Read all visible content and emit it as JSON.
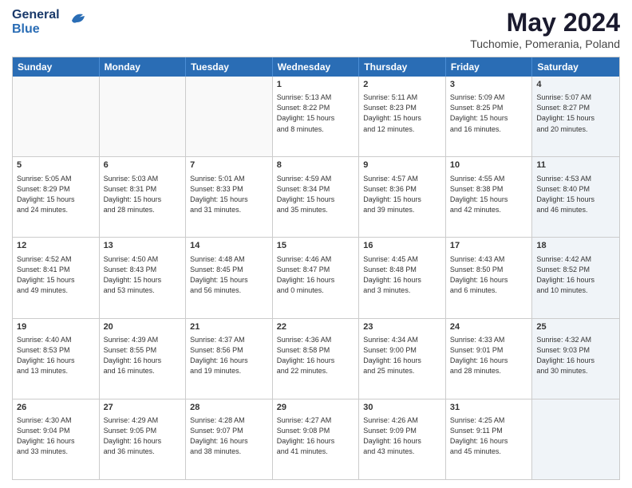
{
  "header": {
    "logo_general": "General",
    "logo_blue": "Blue",
    "title": "May 2024",
    "subtitle": "Tuchomie, Pomerania, Poland"
  },
  "weekdays": [
    "Sunday",
    "Monday",
    "Tuesday",
    "Wednesday",
    "Thursday",
    "Friday",
    "Saturday"
  ],
  "weeks": [
    [
      {
        "day": "",
        "info": "",
        "shaded": false,
        "empty": true
      },
      {
        "day": "",
        "info": "",
        "shaded": false,
        "empty": true
      },
      {
        "day": "",
        "info": "",
        "shaded": false,
        "empty": true
      },
      {
        "day": "1",
        "info": "Sunrise: 5:13 AM\nSunset: 8:22 PM\nDaylight: 15 hours\nand 8 minutes.",
        "shaded": false,
        "empty": false
      },
      {
        "day": "2",
        "info": "Sunrise: 5:11 AM\nSunset: 8:23 PM\nDaylight: 15 hours\nand 12 minutes.",
        "shaded": false,
        "empty": false
      },
      {
        "day": "3",
        "info": "Sunrise: 5:09 AM\nSunset: 8:25 PM\nDaylight: 15 hours\nand 16 minutes.",
        "shaded": false,
        "empty": false
      },
      {
        "day": "4",
        "info": "Sunrise: 5:07 AM\nSunset: 8:27 PM\nDaylight: 15 hours\nand 20 minutes.",
        "shaded": true,
        "empty": false
      }
    ],
    [
      {
        "day": "5",
        "info": "Sunrise: 5:05 AM\nSunset: 8:29 PM\nDaylight: 15 hours\nand 24 minutes.",
        "shaded": false,
        "empty": false
      },
      {
        "day": "6",
        "info": "Sunrise: 5:03 AM\nSunset: 8:31 PM\nDaylight: 15 hours\nand 28 minutes.",
        "shaded": false,
        "empty": false
      },
      {
        "day": "7",
        "info": "Sunrise: 5:01 AM\nSunset: 8:33 PM\nDaylight: 15 hours\nand 31 minutes.",
        "shaded": false,
        "empty": false
      },
      {
        "day": "8",
        "info": "Sunrise: 4:59 AM\nSunset: 8:34 PM\nDaylight: 15 hours\nand 35 minutes.",
        "shaded": false,
        "empty": false
      },
      {
        "day": "9",
        "info": "Sunrise: 4:57 AM\nSunset: 8:36 PM\nDaylight: 15 hours\nand 39 minutes.",
        "shaded": false,
        "empty": false
      },
      {
        "day": "10",
        "info": "Sunrise: 4:55 AM\nSunset: 8:38 PM\nDaylight: 15 hours\nand 42 minutes.",
        "shaded": false,
        "empty": false
      },
      {
        "day": "11",
        "info": "Sunrise: 4:53 AM\nSunset: 8:40 PM\nDaylight: 15 hours\nand 46 minutes.",
        "shaded": true,
        "empty": false
      }
    ],
    [
      {
        "day": "12",
        "info": "Sunrise: 4:52 AM\nSunset: 8:41 PM\nDaylight: 15 hours\nand 49 minutes.",
        "shaded": false,
        "empty": false
      },
      {
        "day": "13",
        "info": "Sunrise: 4:50 AM\nSunset: 8:43 PM\nDaylight: 15 hours\nand 53 minutes.",
        "shaded": false,
        "empty": false
      },
      {
        "day": "14",
        "info": "Sunrise: 4:48 AM\nSunset: 8:45 PM\nDaylight: 15 hours\nand 56 minutes.",
        "shaded": false,
        "empty": false
      },
      {
        "day": "15",
        "info": "Sunrise: 4:46 AM\nSunset: 8:47 PM\nDaylight: 16 hours\nand 0 minutes.",
        "shaded": false,
        "empty": false
      },
      {
        "day": "16",
        "info": "Sunrise: 4:45 AM\nSunset: 8:48 PM\nDaylight: 16 hours\nand 3 minutes.",
        "shaded": false,
        "empty": false
      },
      {
        "day": "17",
        "info": "Sunrise: 4:43 AM\nSunset: 8:50 PM\nDaylight: 16 hours\nand 6 minutes.",
        "shaded": false,
        "empty": false
      },
      {
        "day": "18",
        "info": "Sunrise: 4:42 AM\nSunset: 8:52 PM\nDaylight: 16 hours\nand 10 minutes.",
        "shaded": true,
        "empty": false
      }
    ],
    [
      {
        "day": "19",
        "info": "Sunrise: 4:40 AM\nSunset: 8:53 PM\nDaylight: 16 hours\nand 13 minutes.",
        "shaded": false,
        "empty": false
      },
      {
        "day": "20",
        "info": "Sunrise: 4:39 AM\nSunset: 8:55 PM\nDaylight: 16 hours\nand 16 minutes.",
        "shaded": false,
        "empty": false
      },
      {
        "day": "21",
        "info": "Sunrise: 4:37 AM\nSunset: 8:56 PM\nDaylight: 16 hours\nand 19 minutes.",
        "shaded": false,
        "empty": false
      },
      {
        "day": "22",
        "info": "Sunrise: 4:36 AM\nSunset: 8:58 PM\nDaylight: 16 hours\nand 22 minutes.",
        "shaded": false,
        "empty": false
      },
      {
        "day": "23",
        "info": "Sunrise: 4:34 AM\nSunset: 9:00 PM\nDaylight: 16 hours\nand 25 minutes.",
        "shaded": false,
        "empty": false
      },
      {
        "day": "24",
        "info": "Sunrise: 4:33 AM\nSunset: 9:01 PM\nDaylight: 16 hours\nand 28 minutes.",
        "shaded": false,
        "empty": false
      },
      {
        "day": "25",
        "info": "Sunrise: 4:32 AM\nSunset: 9:03 PM\nDaylight: 16 hours\nand 30 minutes.",
        "shaded": true,
        "empty": false
      }
    ],
    [
      {
        "day": "26",
        "info": "Sunrise: 4:30 AM\nSunset: 9:04 PM\nDaylight: 16 hours\nand 33 minutes.",
        "shaded": false,
        "empty": false
      },
      {
        "day": "27",
        "info": "Sunrise: 4:29 AM\nSunset: 9:05 PM\nDaylight: 16 hours\nand 36 minutes.",
        "shaded": false,
        "empty": false
      },
      {
        "day": "28",
        "info": "Sunrise: 4:28 AM\nSunset: 9:07 PM\nDaylight: 16 hours\nand 38 minutes.",
        "shaded": false,
        "empty": false
      },
      {
        "day": "29",
        "info": "Sunrise: 4:27 AM\nSunset: 9:08 PM\nDaylight: 16 hours\nand 41 minutes.",
        "shaded": false,
        "empty": false
      },
      {
        "day": "30",
        "info": "Sunrise: 4:26 AM\nSunset: 9:09 PM\nDaylight: 16 hours\nand 43 minutes.",
        "shaded": false,
        "empty": false
      },
      {
        "day": "31",
        "info": "Sunrise: 4:25 AM\nSunset: 9:11 PM\nDaylight: 16 hours\nand 45 minutes.",
        "shaded": false,
        "empty": false
      },
      {
        "day": "",
        "info": "",
        "shaded": true,
        "empty": true
      }
    ]
  ]
}
